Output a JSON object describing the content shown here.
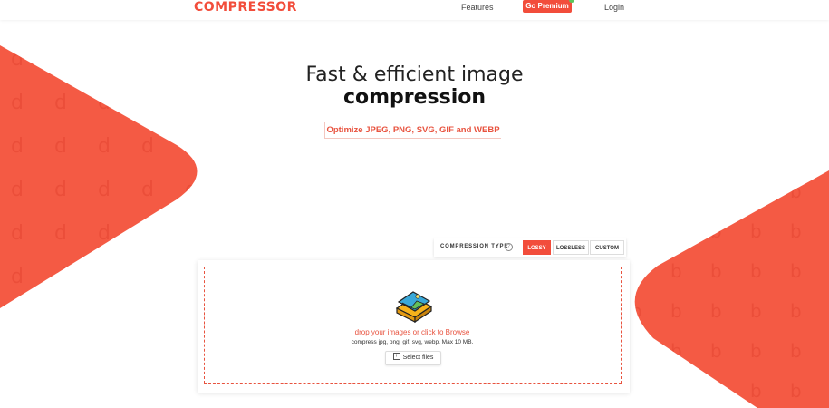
{
  "header": {
    "logo_text": "OMPRESSOR",
    "logo_initial": "C",
    "nav": {
      "features_label": "Features",
      "premium_label": "Go Premium",
      "login_label": "Login"
    }
  },
  "hero": {
    "title_line1": "Fast & efficient image",
    "title_line2": "compression",
    "tagline": "Optimize JPEG, PNG, SVG, GIF and WEBP"
  },
  "compression": {
    "label": "COMPRESSION TYPE",
    "info_icon": "info-icon",
    "options": [
      "LOSSY",
      "LOSSLESS",
      "CUSTOM"
    ],
    "selected": "LOSSY"
  },
  "dropzone": {
    "icon": "image-stack-icon",
    "title": "drop your images or click to Browse",
    "subtitle": "compress jpg, png, gif, svg, webp. Max 10 MB.",
    "select_label": "Select files"
  },
  "colors": {
    "accent": "#f24d3b",
    "accent_text": "#e8533f",
    "premium_badge": "#5cc65c"
  }
}
